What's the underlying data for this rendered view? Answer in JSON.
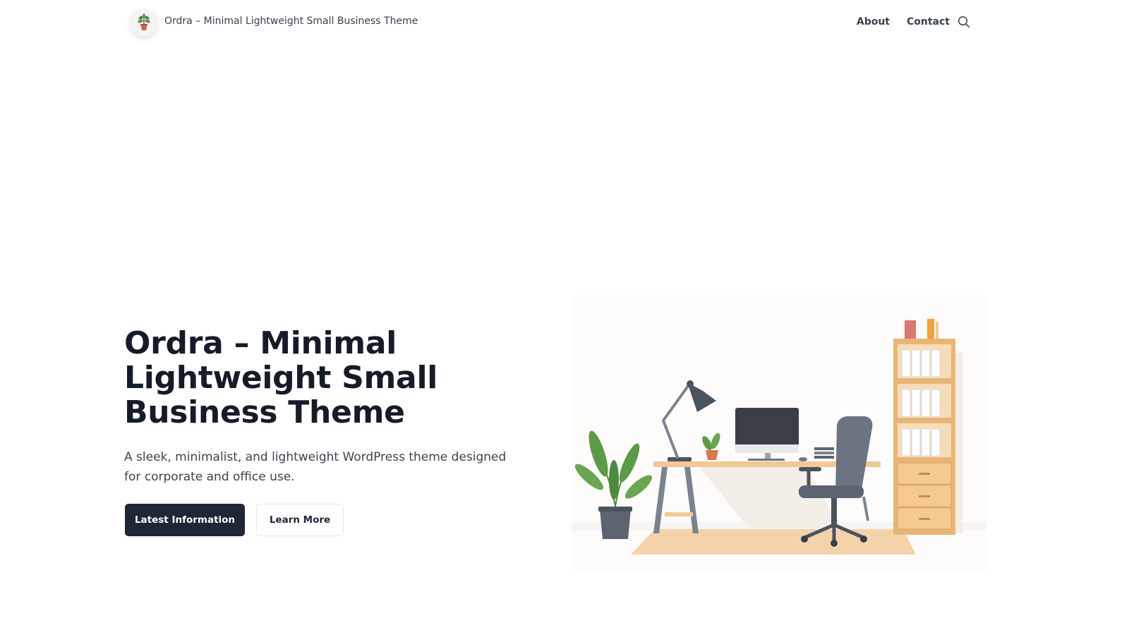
{
  "header": {
    "site_title": "Ordra – Minimal Lightweight Small Business Theme",
    "logo_icon": "potted-plant-icon",
    "nav": [
      {
        "label": "About"
      },
      {
        "label": "Contact"
      }
    ],
    "search_icon": "search-icon"
  },
  "hero": {
    "title": "Ordra – Minimal Lightweight Small Business Theme",
    "description": "A sleek, minimalist, and lightweight WordPress theme designed for corporate and office use.",
    "primary_button": "Latest Information",
    "secondary_button": "Learn More"
  },
  "colors": {
    "primary_button_bg": "#1e2736",
    "heading": "#151b28",
    "desk_wood": "#f2c898",
    "shelf_wood": "#e9b576"
  }
}
